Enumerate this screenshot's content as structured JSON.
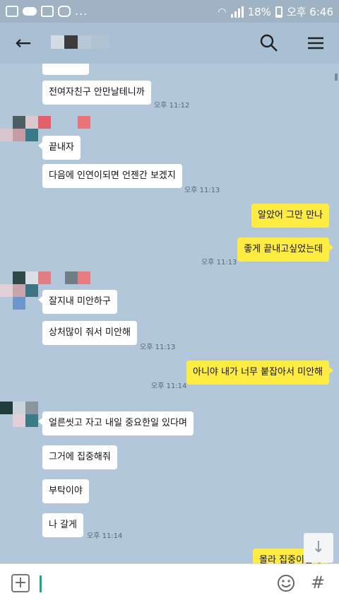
{
  "status_bar": {
    "battery": "18%",
    "time": "오후 6:46",
    "dots": "..."
  },
  "header": {
    "back_icon": "arrow-left-icon",
    "search_icon": "search-icon",
    "menu_icon": "hamburger-menu-icon"
  },
  "messages": [
    {
      "side": "in",
      "text": "전여자친구 안만날테니까",
      "time": "오후 11:12"
    },
    {
      "side": "in",
      "text": "끝내자",
      "time": ""
    },
    {
      "side": "in",
      "text": "다음에 인연이되면 언젠간 보겠지",
      "time": "오후 11:13"
    },
    {
      "side": "out",
      "text": "알았어 그만 만나",
      "time": ""
    },
    {
      "side": "out",
      "text": "좋게 끝내고싶었는데",
      "time": "오후 11:13"
    },
    {
      "side": "in",
      "text": "잘지내 미안하구",
      "time": ""
    },
    {
      "side": "in",
      "text": "상처많이 줘서 미안해",
      "time": "오후 11:13"
    },
    {
      "side": "out",
      "text": "아니야 내가 너무 붙잡아서 미안해",
      "time": "오후 11:14"
    },
    {
      "side": "in",
      "text": "얼른씻고 자고 내일 중요한일 있다며",
      "time": ""
    },
    {
      "side": "in",
      "text": "그거에 집중해줘",
      "time": ""
    },
    {
      "side": "in",
      "text": "부탁이야",
      "time": ""
    },
    {
      "side": "in",
      "text": "나 갈게",
      "time": "오후 11:14"
    },
    {
      "side": "out",
      "text": "몰라 집중이안돼",
      "time": ""
    }
  ],
  "colors": {
    "background": "#b2c7d9",
    "outgoing_bubble": "#ffec42",
    "incoming_bubble": "#ffffff"
  }
}
